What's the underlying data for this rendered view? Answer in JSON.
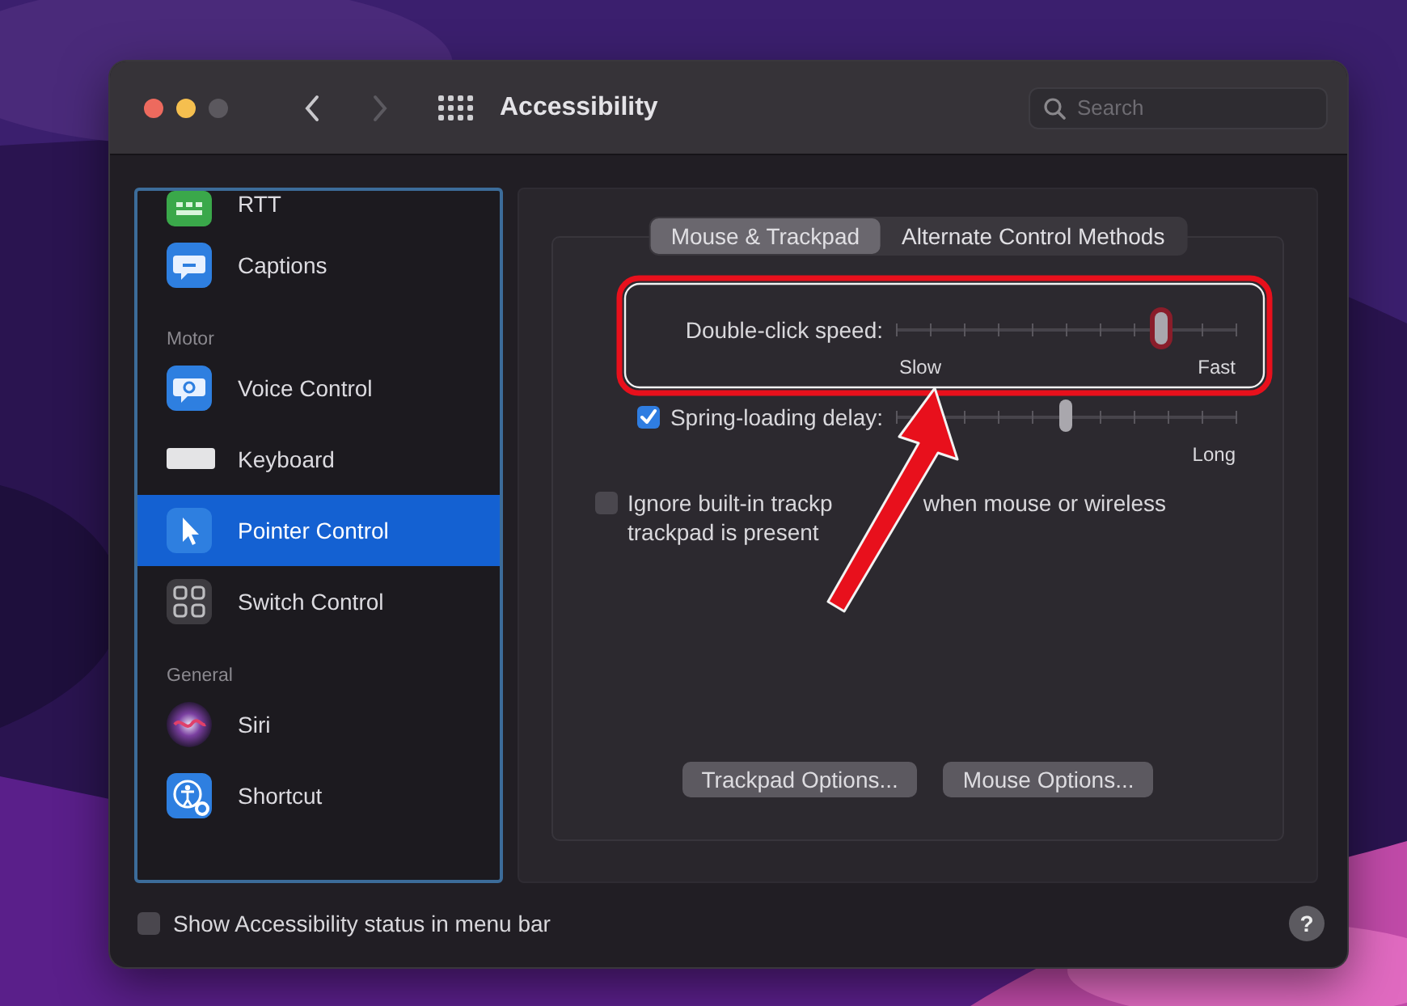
{
  "window": {
    "title": "Accessibility"
  },
  "toolbar": {
    "back_enabled": true,
    "forward_enabled": false
  },
  "search": {
    "placeholder": "Search"
  },
  "sidebar": {
    "items": [
      {
        "kind": "item",
        "label": "RTT",
        "selected": false
      },
      {
        "kind": "item",
        "label": "Captions",
        "selected": false
      },
      {
        "kind": "header",
        "label": "Motor"
      },
      {
        "kind": "item",
        "label": "Voice Control",
        "selected": false
      },
      {
        "kind": "item",
        "label": "Keyboard",
        "selected": false
      },
      {
        "kind": "item",
        "label": "Pointer Control",
        "selected": true
      },
      {
        "kind": "item",
        "label": "Switch Control",
        "selected": false
      },
      {
        "kind": "header",
        "label": "General"
      },
      {
        "kind": "item",
        "label": "Siri",
        "selected": false
      },
      {
        "kind": "item",
        "label": "Shortcut",
        "selected": false
      }
    ]
  },
  "tabs": [
    {
      "label": "Mouse & Trackpad",
      "selected": true
    },
    {
      "label": "Alternate Control Methods",
      "selected": false
    }
  ],
  "controls": [
    {
      "kind": "slider",
      "label": "Double-click speed:",
      "level": 0.78,
      "min_label": "Slow",
      "max_label": "Fast"
    },
    {
      "kind": "check-slider",
      "label": "Spring-loading delay:",
      "checked": true,
      "level": 0.5,
      "max_label": "Long"
    },
    {
      "kind": "checkbox",
      "lines": [
        [
          "Ignore built-in trackp",
          "when mouse or wireless"
        ],
        [
          "trackpad is present"
        ]
      ],
      "checked": false
    }
  ],
  "buttons": [
    "Trackpad Options...",
    "Mouse Options..."
  ],
  "footer": {
    "label": "Show Accessibility status in menu bar",
    "checked": false,
    "help": "?"
  },
  "annotations": [
    {
      "kind": "highlight-box"
    },
    {
      "kind": "arrow"
    }
  ]
}
